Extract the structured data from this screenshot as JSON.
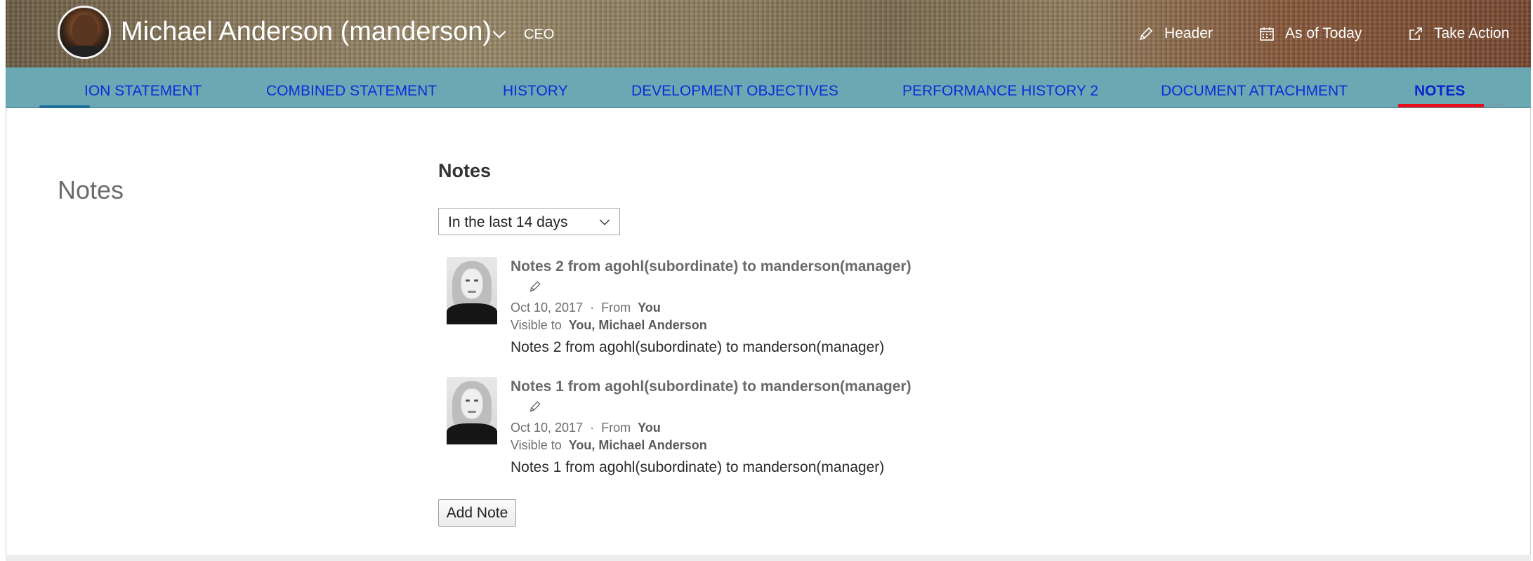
{
  "header": {
    "name": "Michael Anderson (manderson)",
    "role": "CEO",
    "actions": [
      {
        "label": "Header",
        "icon": "pencil-icon"
      },
      {
        "label": "As of Today",
        "icon": "calendar-icon"
      },
      {
        "label": "Take Action",
        "icon": "share-icon"
      }
    ]
  },
  "tabs": [
    {
      "label": "ION STATEMENT",
      "active": false
    },
    {
      "label": "COMBINED STATEMENT",
      "active": false
    },
    {
      "label": "HISTORY",
      "active": false
    },
    {
      "label": "DEVELOPMENT OBJECTIVES",
      "active": false
    },
    {
      "label": "PERFORMANCE HISTORY 2",
      "active": false
    },
    {
      "label": "DOCUMENT ATTACHMENT",
      "active": false
    },
    {
      "label": "NOTES",
      "active": true
    }
  ],
  "more_label": "...",
  "section": {
    "title": "Notes"
  },
  "notes_panel": {
    "title": "Notes",
    "filter_value": "In the last 14 days",
    "add_label": "Add Note",
    "notes": [
      {
        "title": "Notes 2 from agohl(subordinate) to manderson(manager)",
        "date": "Oct 10, 2017",
        "from_label": "From",
        "from": "You",
        "visible_label": "Visible to",
        "visible_to": "You, Michael Anderson",
        "body": "Notes 2 from agohl(subordinate) to manderson(manager)"
      },
      {
        "title": "Notes 1 from agohl(subordinate) to manderson(manager)",
        "date": "Oct 10, 2017",
        "from_label": "From",
        "from": "You",
        "visible_label": "Visible to",
        "visible_to": "You, Michael Anderson",
        "body": "Notes 1 from agohl(subordinate) to manderson(manager)"
      }
    ]
  },
  "colors": {
    "tab_bar": "#6aa9b4",
    "tab_text": "#0b2cd8",
    "active_underline": "#e8101c"
  }
}
